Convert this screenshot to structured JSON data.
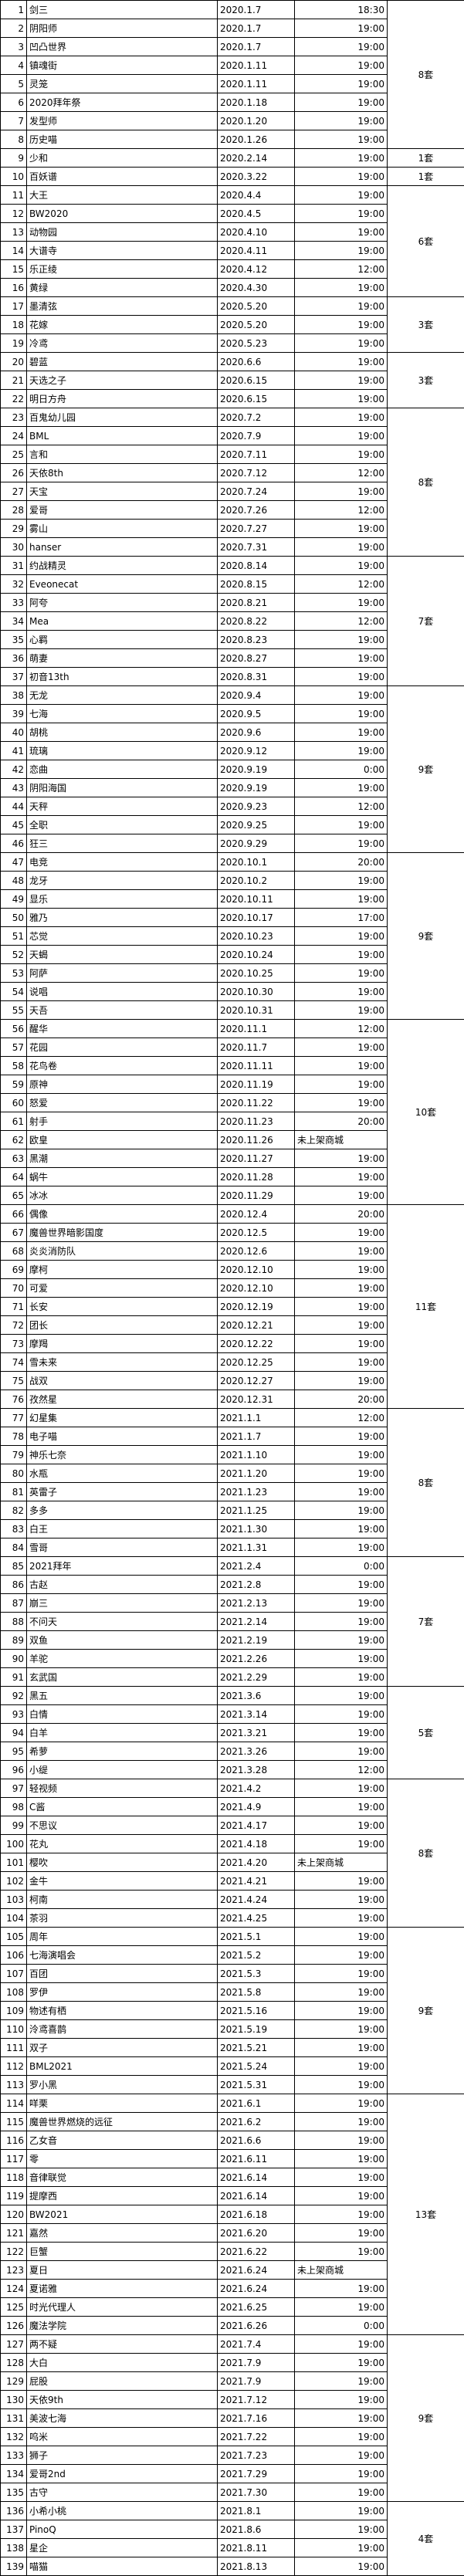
{
  "rows": [
    {
      "n": 1,
      "name": "剑三",
      "date": "2020.1.7",
      "time": "18:30"
    },
    {
      "n": 2,
      "name": "阴阳师",
      "date": "2020.1.7",
      "time": "19:00"
    },
    {
      "n": 3,
      "name": "凹凸世界",
      "date": "2020.1.7",
      "time": "19:00"
    },
    {
      "n": 4,
      "name": "镇魂街",
      "date": "2020.1.11",
      "time": "19:00"
    },
    {
      "n": 5,
      "name": "灵笼",
      "date": "2020.1.11",
      "time": "19:00"
    },
    {
      "n": 6,
      "name": "2020拜年祭",
      "date": "2020.1.18",
      "time": "19:00"
    },
    {
      "n": 7,
      "name": "发型师",
      "date": "2020.1.20",
      "time": "19:00"
    },
    {
      "n": 8,
      "name": "历史喵",
      "date": "2020.1.26",
      "time": "19:00"
    },
    {
      "n": 9,
      "name": "少和",
      "date": "2020.2.14",
      "time": "19:00"
    },
    {
      "n": 10,
      "name": "百妖谱",
      "date": "2020.3.22",
      "time": "19:00"
    },
    {
      "n": 11,
      "name": "大王",
      "date": "2020.4.4",
      "time": "19:00"
    },
    {
      "n": 12,
      "name": "BW2020",
      "date": "2020.4.5",
      "time": "19:00"
    },
    {
      "n": 13,
      "name": "动物园",
      "date": "2020.4.10",
      "time": "19:00"
    },
    {
      "n": 14,
      "name": "大谱寺",
      "date": "2020.4.11",
      "time": "19:00"
    },
    {
      "n": 15,
      "name": "乐正绫",
      "date": "2020.4.12",
      "time": "12:00"
    },
    {
      "n": 16,
      "name": "黄绿",
      "date": "2020.4.30",
      "time": "19:00"
    },
    {
      "n": 17,
      "name": "墨清弦",
      "date": "2020.5.20",
      "time": "19:00"
    },
    {
      "n": 18,
      "name": "花嫁",
      "date": "2020.5.20",
      "time": "19:00"
    },
    {
      "n": 19,
      "name": "冷鸢",
      "date": "2020.5.23",
      "time": "19:00"
    },
    {
      "n": 20,
      "name": "碧蓝",
      "date": "2020.6.6",
      "time": "19:00"
    },
    {
      "n": 21,
      "name": "天选之子",
      "date": "2020.6.15",
      "time": "19:00"
    },
    {
      "n": 22,
      "name": "明日方舟",
      "date": "2020.6.15",
      "time": "19:00"
    },
    {
      "n": 23,
      "name": "百鬼幼儿园",
      "date": "2020.7.2",
      "time": "19:00"
    },
    {
      "n": 24,
      "name": "BML",
      "date": "2020.7.9",
      "time": "19:00"
    },
    {
      "n": 25,
      "name": "言和",
      "date": "2020.7.11",
      "time": "19:00"
    },
    {
      "n": 26,
      "name": "天依8th",
      "date": "2020.7.12",
      "time": "12:00"
    },
    {
      "n": 27,
      "name": "天宝",
      "date": "2020.7.24",
      "time": "19:00"
    },
    {
      "n": 28,
      "name": "爱哥",
      "date": "2020.7.26",
      "time": "12:00"
    },
    {
      "n": 29,
      "name": "雾山",
      "date": "2020.7.27",
      "time": "19:00"
    },
    {
      "n": 30,
      "name": "hanser",
      "date": "2020.7.31",
      "time": "19:00"
    },
    {
      "n": 31,
      "name": "约战精灵",
      "date": "2020.8.14",
      "time": "19:00"
    },
    {
      "n": 32,
      "name": "Eveonecat",
      "date": "2020.8.15",
      "time": "12:00"
    },
    {
      "n": 33,
      "name": "阿夸",
      "date": "2020.8.21",
      "time": "19:00"
    },
    {
      "n": 34,
      "name": "Mea",
      "date": "2020.8.22",
      "time": "12:00"
    },
    {
      "n": 35,
      "name": "心羁",
      "date": "2020.8.23",
      "time": "19:00"
    },
    {
      "n": 36,
      "name": "萌妻",
      "date": "2020.8.27",
      "time": "19:00"
    },
    {
      "n": 37,
      "name": "初音13th",
      "date": "2020.8.31",
      "time": "19:00"
    },
    {
      "n": 38,
      "name": "无龙",
      "date": "2020.9.4",
      "time": "19:00"
    },
    {
      "n": 39,
      "name": "七海",
      "date": "2020.9.5",
      "time": "19:00"
    },
    {
      "n": 40,
      "name": "胡桃",
      "date": "2020.9.6",
      "time": "19:00"
    },
    {
      "n": 41,
      "name": "琉璃",
      "date": "2020.9.12",
      "time": "19:00"
    },
    {
      "n": 42,
      "name": "恋曲",
      "date": "2020.9.19",
      "time": "0:00"
    },
    {
      "n": 43,
      "name": "阴阳海国",
      "date": "2020.9.19",
      "time": "19:00"
    },
    {
      "n": 44,
      "name": "天秤",
      "date": "2020.9.23",
      "time": "12:00"
    },
    {
      "n": 45,
      "name": "全职",
      "date": "2020.9.25",
      "time": "19:00"
    },
    {
      "n": 46,
      "name": "狂三",
      "date": "2020.9.29",
      "time": "19:00"
    },
    {
      "n": 47,
      "name": "电竞",
      "date": "2020.10.1",
      "time": "20:00"
    },
    {
      "n": 48,
      "name": "龙牙",
      "date": "2020.10.2",
      "time": "19:00"
    },
    {
      "n": 49,
      "name": "显乐",
      "date": "2020.10.11",
      "time": "19:00"
    },
    {
      "n": 50,
      "name": "雅乃",
      "date": "2020.10.17",
      "time": "17:00"
    },
    {
      "n": 51,
      "name": "芯觉",
      "date": "2020.10.23",
      "time": "19:00"
    },
    {
      "n": 52,
      "name": "天蝎",
      "date": "2020.10.24",
      "time": "19:00"
    },
    {
      "n": 53,
      "name": "阿萨",
      "date": "2020.10.25",
      "time": "19:00"
    },
    {
      "n": 54,
      "name": "说唱",
      "date": "2020.10.30",
      "time": "19:00"
    },
    {
      "n": 55,
      "name": "天吾",
      "date": "2020.10.31",
      "time": "19:00"
    },
    {
      "n": 56,
      "name": "醒华",
      "date": "2020.11.1",
      "time": "12:00"
    },
    {
      "n": 57,
      "name": "花园",
      "date": "2020.11.7",
      "time": "19:00"
    },
    {
      "n": 58,
      "name": "花鸟卷",
      "date": "2020.11.11",
      "time": "19:00"
    },
    {
      "n": 59,
      "name": "原神",
      "date": "2020.11.19",
      "time": "19:00"
    },
    {
      "n": 60,
      "name": "怒爱",
      "date": "2020.11.22",
      "time": "19:00"
    },
    {
      "n": 61,
      "name": "射手",
      "date": "2020.11.23",
      "time": "20:00"
    },
    {
      "n": 62,
      "name": "欧皇",
      "date": "2020.11.26",
      "time": "未上架商城"
    },
    {
      "n": 63,
      "name": "黑潮",
      "date": "2020.11.27",
      "time": "19:00"
    },
    {
      "n": 64,
      "name": "蜗牛",
      "date": "2020.11.28",
      "time": "19:00"
    },
    {
      "n": 65,
      "name": "冰冰",
      "date": "2020.11.29",
      "time": "19:00"
    },
    {
      "n": 66,
      "name": "偶像",
      "date": "2020.12.4",
      "time": "20:00"
    },
    {
      "n": 67,
      "name": "魔兽世界暗影国度",
      "date": "2020.12.5",
      "time": "19:00"
    },
    {
      "n": 68,
      "name": "炎炎消防队",
      "date": "2020.12.6",
      "time": "19:00"
    },
    {
      "n": 69,
      "name": "摩柯",
      "date": "2020.12.10",
      "time": "19:00"
    },
    {
      "n": 70,
      "name": "可爱",
      "date": "2020.12.10",
      "time": "19:00"
    },
    {
      "n": 71,
      "name": "长安",
      "date": "2020.12.19",
      "time": "19:00"
    },
    {
      "n": 72,
      "name": "团长",
      "date": "2020.12.21",
      "time": "19:00"
    },
    {
      "n": 73,
      "name": "摩羯",
      "date": "2020.12.22",
      "time": "19:00"
    },
    {
      "n": 74,
      "name": "雪未来",
      "date": "2020.12.25",
      "time": "19:00"
    },
    {
      "n": 75,
      "name": "战双",
      "date": "2020.12.27",
      "time": "19:00"
    },
    {
      "n": 76,
      "name": "孜然星",
      "date": "2020.12.31",
      "time": "20:00"
    },
    {
      "n": 77,
      "name": "幻星集",
      "date": "2021.1.1",
      "time": "12:00"
    },
    {
      "n": 78,
      "name": "电子喵",
      "date": "2021.1.7",
      "time": "19:00"
    },
    {
      "n": 79,
      "name": "神乐七奈",
      "date": "2021.1.10",
      "time": "19:00"
    },
    {
      "n": 80,
      "name": "水瓶",
      "date": "2021.1.20",
      "time": "19:00"
    },
    {
      "n": 81,
      "name": "英雷子",
      "date": "2021.1.23",
      "time": "19:00"
    },
    {
      "n": 82,
      "name": "多多",
      "date": "2021.1.25",
      "time": "19:00"
    },
    {
      "n": 83,
      "name": "白王",
      "date": "2021.1.30",
      "time": "19:00"
    },
    {
      "n": 84,
      "name": "雪哥",
      "date": "2021.1.31",
      "time": "19:00"
    },
    {
      "n": 85,
      "name": "2021拜年",
      "date": "2021.2.4",
      "time": "0:00"
    },
    {
      "n": 86,
      "name": "古赵",
      "date": "2021.2.8",
      "time": "19:00"
    },
    {
      "n": 87,
      "name": "崩三",
      "date": "2021.2.13",
      "time": "19:00"
    },
    {
      "n": 88,
      "name": "不问天",
      "date": "2021.2.14",
      "time": "19:00"
    },
    {
      "n": 89,
      "name": "双鱼",
      "date": "2021.2.19",
      "time": "19:00"
    },
    {
      "n": 90,
      "name": "羊驼",
      "date": "2021.2.26",
      "time": "19:00"
    },
    {
      "n": 91,
      "name": "玄武国",
      "date": "2021.2.29",
      "time": "19:00"
    },
    {
      "n": 92,
      "name": "黑五",
      "date": "2021.3.6",
      "time": "19:00"
    },
    {
      "n": 93,
      "name": "白情",
      "date": "2021.3.14",
      "time": "19:00"
    },
    {
      "n": 94,
      "name": "白羊",
      "date": "2021.3.21",
      "time": "19:00"
    },
    {
      "n": 95,
      "name": "希萝",
      "date": "2021.3.26",
      "time": "19:00"
    },
    {
      "n": 96,
      "name": "小缇",
      "date": "2021.3.28",
      "time": "12:00"
    },
    {
      "n": 97,
      "name": "轻视频",
      "date": "2021.4.2",
      "time": "19:00"
    },
    {
      "n": 98,
      "name": "C酱",
      "date": "2021.4.9",
      "time": "19:00"
    },
    {
      "n": 99,
      "name": "不思议",
      "date": "2021.4.17",
      "time": "19:00"
    },
    {
      "n": 100,
      "name": "花丸",
      "date": "2021.4.18",
      "time": "19:00"
    },
    {
      "n": 101,
      "name": "樱吹",
      "date": "2021.4.20",
      "time": "未上架商城"
    },
    {
      "n": 102,
      "name": "金牛",
      "date": "2021.4.21",
      "time": "19:00"
    },
    {
      "n": 103,
      "name": "柯南",
      "date": "2021.4.24",
      "time": "19:00"
    },
    {
      "n": 104,
      "name": "茶羽",
      "date": "2021.4.25",
      "time": "19:00"
    },
    {
      "n": 105,
      "name": "周年",
      "date": "2021.5.1",
      "time": "19:00"
    },
    {
      "n": 106,
      "name": "七海演唱会",
      "date": "2021.5.2",
      "time": "19:00"
    },
    {
      "n": 107,
      "name": "百团",
      "date": "2021.5.3",
      "time": "19:00"
    },
    {
      "n": 108,
      "name": "罗伊",
      "date": "2021.5.8",
      "time": "19:00"
    },
    {
      "n": 109,
      "name": "物述有栖",
      "date": "2021.5.16",
      "time": "19:00"
    },
    {
      "n": 110,
      "name": "泠鸢喜鹊",
      "date": "2021.5.19",
      "time": "19:00"
    },
    {
      "n": 111,
      "name": "双子",
      "date": "2021.5.21",
      "time": "19:00"
    },
    {
      "n": 112,
      "name": "BML2021",
      "date": "2021.5.24",
      "time": "19:00"
    },
    {
      "n": 113,
      "name": "罗小黑",
      "date": "2021.5.31",
      "time": "19:00"
    },
    {
      "n": 114,
      "name": "咩栗",
      "date": "2021.6.1",
      "time": "19:00"
    },
    {
      "n": 115,
      "name": "魔兽世界燃烧的远征",
      "date": "2021.6.2",
      "time": "19:00"
    },
    {
      "n": 116,
      "name": "乙女音",
      "date": "2021.6.6",
      "time": "19:00"
    },
    {
      "n": 117,
      "name": "零",
      "date": "2021.6.11",
      "time": "19:00"
    },
    {
      "n": 118,
      "name": "音律联觉",
      "date": "2021.6.14",
      "time": "19:00"
    },
    {
      "n": 119,
      "name": "提摩西",
      "date": "2021.6.14",
      "time": "19:00"
    },
    {
      "n": 120,
      "name": "BW2021",
      "date": "2021.6.18",
      "time": "19:00"
    },
    {
      "n": 121,
      "name": "嘉然",
      "date": "2021.6.20",
      "time": "19:00"
    },
    {
      "n": 122,
      "name": "巨蟹",
      "date": "2021.6.22",
      "time": "19:00"
    },
    {
      "n": 123,
      "name": "夏日",
      "date": "2021.6.24",
      "time": "未上架商城"
    },
    {
      "n": 124,
      "name": "夏诺雅",
      "date": "2021.6.24",
      "time": "19:00"
    },
    {
      "n": 125,
      "name": "时光代理人",
      "date": "2021.6.25",
      "time": "19:00"
    },
    {
      "n": 126,
      "name": "魔法学院",
      "date": "2021.6.26",
      "time": "0:00"
    },
    {
      "n": 127,
      "name": "两不疑",
      "date": "2021.7.4",
      "time": "19:00"
    },
    {
      "n": 128,
      "name": "大白",
      "date": "2021.7.9",
      "time": "19:00"
    },
    {
      "n": 129,
      "name": "屁股",
      "date": "2021.7.9",
      "time": "19:00"
    },
    {
      "n": 130,
      "name": "天依9th",
      "date": "2021.7.12",
      "time": "19:00"
    },
    {
      "n": 131,
      "name": "美波七海",
      "date": "2021.7.16",
      "time": "19:00"
    },
    {
      "n": 132,
      "name": "呜米",
      "date": "2021.7.22",
      "time": "19:00"
    },
    {
      "n": 133,
      "name": "狮子",
      "date": "2021.7.23",
      "time": "19:00"
    },
    {
      "n": 134,
      "name": "爱哥2nd",
      "date": "2021.7.29",
      "time": "19:00"
    },
    {
      "n": 135,
      "name": "古守",
      "date": "2021.7.30",
      "time": "19:00"
    },
    {
      "n": 136,
      "name": "小希小桃",
      "date": "2021.8.1",
      "time": "19:00"
    },
    {
      "n": 137,
      "name": "PinoQ",
      "date": "2021.8.6",
      "time": "19:00"
    },
    {
      "n": 138,
      "name": "星企",
      "date": "2021.8.11",
      "time": "19:00"
    },
    {
      "n": 139,
      "name": "喵猫",
      "date": "2021.8.13",
      "time": "19:00"
    }
  ],
  "groups": [
    {
      "start": 1,
      "span": 8,
      "label": "8套"
    },
    {
      "start": 9,
      "span": 1,
      "label": "1套"
    },
    {
      "start": 10,
      "span": 1,
      "label": "1套"
    },
    {
      "start": 11,
      "span": 6,
      "label": "6套"
    },
    {
      "start": 17,
      "span": 3,
      "label": "3套"
    },
    {
      "start": 20,
      "span": 3,
      "label": "3套"
    },
    {
      "start": 23,
      "span": 8,
      "label": "8套"
    },
    {
      "start": 31,
      "span": 7,
      "label": "7套"
    },
    {
      "start": 38,
      "span": 9,
      "label": "9套"
    },
    {
      "start": 47,
      "span": 9,
      "label": "9套"
    },
    {
      "start": 56,
      "span": 10,
      "label": "10套"
    },
    {
      "start": 66,
      "span": 11,
      "label": "11套"
    },
    {
      "start": 77,
      "span": 8,
      "label": "8套"
    },
    {
      "start": 85,
      "span": 7,
      "label": "7套"
    },
    {
      "start": 92,
      "span": 5,
      "label": "5套"
    },
    {
      "start": 97,
      "span": 8,
      "label": "8套"
    },
    {
      "start": 105,
      "span": 9,
      "label": "9套"
    },
    {
      "start": 114,
      "span": 13,
      "label": "13套"
    },
    {
      "start": 127,
      "span": 9,
      "label": "9套"
    },
    {
      "start": 136,
      "span": 4,
      "label": "4套"
    }
  ]
}
